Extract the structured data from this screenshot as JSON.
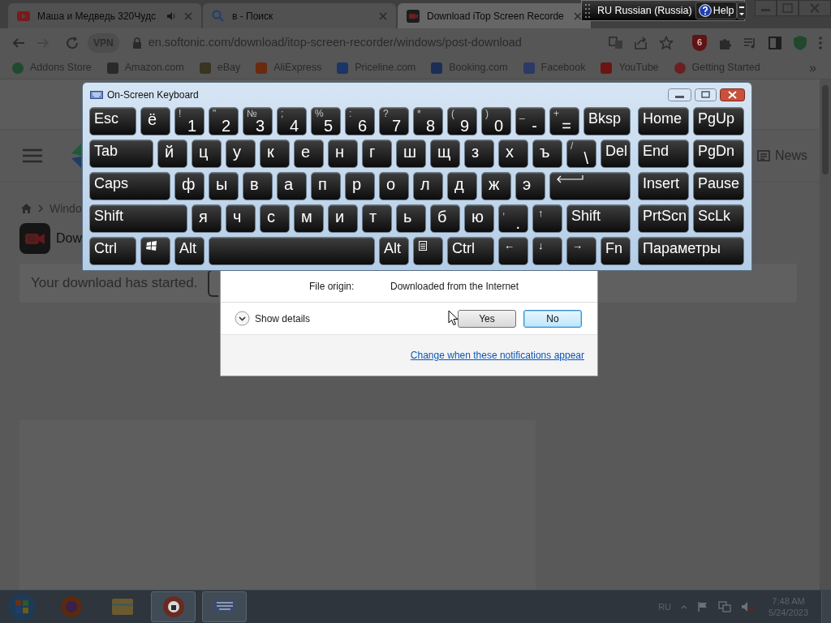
{
  "browser": {
    "tabs": [
      {
        "title": "Маша и Медведь 320Чудс",
        "selected": false,
        "audio": true
      },
      {
        "title": "в - Поиск",
        "selected": false,
        "audio": false
      },
      {
        "title": "Download iTop Screen Recorde",
        "selected": true,
        "audio": false
      }
    ],
    "vpn": "VPN",
    "address": "en.softonic.com/download/itop-screen-recorder/windows/post-download",
    "extension_badge": "6",
    "bookmarks": [
      {
        "label": "Addons Store"
      },
      {
        "label": "Amazon.com"
      },
      {
        "label": "eBay"
      },
      {
        "label": "AliExpress"
      },
      {
        "label": "Priceline.com"
      },
      {
        "label": "Booking.com"
      },
      {
        "label": "Facebook"
      },
      {
        "label": "YouTube"
      },
      {
        "label": "Getting Started"
      }
    ],
    "bookmarks_overflow": "»"
  },
  "page": {
    "nav_link": "News",
    "breadcrumb": "Windo",
    "app_title": "Dow",
    "download_message": "Your download has started."
  },
  "language_bar": {
    "language": "RU Russian (Russia)",
    "help": "Help"
  },
  "keyboard": {
    "title": "On-Screen Keyboard",
    "key_rows": [
      {
        "keys": [
          {
            "kind": "text",
            "label": "Esc"
          },
          {
            "kind": "letter",
            "label": "ё"
          },
          {
            "kind": "pair",
            "upper": "!",
            "lower": "1"
          },
          {
            "kind": "pair",
            "upper": "\"",
            "lower": "2"
          },
          {
            "kind": "pair",
            "upper": "№",
            "lower": "3"
          },
          {
            "kind": "pair",
            "upper": ";",
            "lower": "4"
          },
          {
            "kind": "pair",
            "upper": "%",
            "lower": "5"
          },
          {
            "kind": "pair",
            "upper": ":",
            "lower": "6"
          },
          {
            "kind": "pair",
            "upper": "?",
            "lower": "7"
          },
          {
            "kind": "pair",
            "upper": "*",
            "lower": "8"
          },
          {
            "kind": "pair",
            "upper": "(",
            "lower": "9"
          },
          {
            "kind": "pair",
            "upper": ")",
            "lower": "0"
          },
          {
            "kind": "pair",
            "upper": "_",
            "lower": "-"
          },
          {
            "kind": "pair",
            "upper": "+",
            "lower": "="
          },
          {
            "kind": "text",
            "label": "Bksp"
          }
        ]
      },
      {
        "keys": [
          {
            "kind": "text",
            "label": "Tab"
          },
          {
            "kind": "letter",
            "label": "й"
          },
          {
            "kind": "letter",
            "label": "ц"
          },
          {
            "kind": "letter",
            "label": "у"
          },
          {
            "kind": "letter",
            "label": "к"
          },
          {
            "kind": "letter",
            "label": "е"
          },
          {
            "kind": "letter",
            "label": "н"
          },
          {
            "kind": "letter",
            "label": "г"
          },
          {
            "kind": "letter",
            "label": "ш"
          },
          {
            "kind": "letter",
            "label": "щ"
          },
          {
            "kind": "letter",
            "label": "з"
          },
          {
            "kind": "letter",
            "label": "х"
          },
          {
            "kind": "letter",
            "label": "ъ"
          },
          {
            "kind": "pair",
            "upper": "/",
            "lower": "\\"
          },
          {
            "kind": "text",
            "label": "Del"
          }
        ]
      },
      {
        "keys": [
          {
            "kind": "text",
            "label": "Caps"
          },
          {
            "kind": "letter",
            "label": "ф"
          },
          {
            "kind": "letter",
            "label": "ы"
          },
          {
            "kind": "letter",
            "label": "в"
          },
          {
            "kind": "letter",
            "label": "а"
          },
          {
            "kind": "letter",
            "label": "п"
          },
          {
            "kind": "letter",
            "label": "р"
          },
          {
            "kind": "letter",
            "label": "о"
          },
          {
            "kind": "letter",
            "label": "л"
          },
          {
            "kind": "letter",
            "label": "д"
          },
          {
            "kind": "letter",
            "label": "ж"
          },
          {
            "kind": "letter",
            "label": "э"
          },
          {
            "kind": "enter"
          }
        ]
      },
      {
        "keys": [
          {
            "kind": "text",
            "label": "Shift"
          },
          {
            "kind": "letter",
            "label": "я"
          },
          {
            "kind": "letter",
            "label": "ч"
          },
          {
            "kind": "letter",
            "label": "с"
          },
          {
            "kind": "letter",
            "label": "м"
          },
          {
            "kind": "letter",
            "label": "и"
          },
          {
            "kind": "letter",
            "label": "т"
          },
          {
            "kind": "letter",
            "label": "ь"
          },
          {
            "kind": "letter",
            "label": "б"
          },
          {
            "kind": "letter",
            "label": "ю"
          },
          {
            "kind": "pair",
            "upper": ",",
            "lower": "."
          },
          {
            "kind": "arrow",
            "label": "↑"
          },
          {
            "kind": "text",
            "label": "Shift"
          }
        ]
      },
      {
        "keys": [
          {
            "kind": "text",
            "label": "Ctrl"
          },
          {
            "kind": "windows"
          },
          {
            "kind": "text",
            "label": "Alt"
          },
          {
            "kind": "space"
          },
          {
            "kind": "text",
            "label": "Alt"
          },
          {
            "kind": "menu"
          },
          {
            "kind": "text",
            "label": "Ctrl"
          },
          {
            "kind": "arrow",
            "label": "←"
          },
          {
            "kind": "arrow",
            "label": "↓"
          },
          {
            "kind": "arrow",
            "label": "→"
          },
          {
            "kind": "text",
            "label": "Fn"
          }
        ]
      }
    ],
    "nav_key_rows": [
      {
        "keys": [
          "Home",
          "PgUp"
        ]
      },
      {
        "keys": [
          "End",
          "PgDn"
        ]
      },
      {
        "keys": [
          "Insert",
          "Pause"
        ]
      },
      {
        "keys": [
          "PrtScn",
          "ScLk"
        ]
      },
      {
        "keys": [
          "Параметры"
        ]
      }
    ]
  },
  "dialog": {
    "field_label": "File origin:",
    "field_value": "Downloaded from the Internet",
    "details_toggle": "Show details",
    "expanded": false,
    "buttons": [
      {
        "label": "Yes",
        "selected": false
      },
      {
        "label": "No",
        "selected": true
      }
    ],
    "link": "Change when these notifications appear"
  },
  "taskbar": {
    "apps": [
      {
        "active": false
      },
      {
        "active": false
      },
      {
        "active": true
      },
      {
        "active": true
      }
    ],
    "language": "RU",
    "time": "7:48 AM",
    "date": "5/24/2023"
  }
}
